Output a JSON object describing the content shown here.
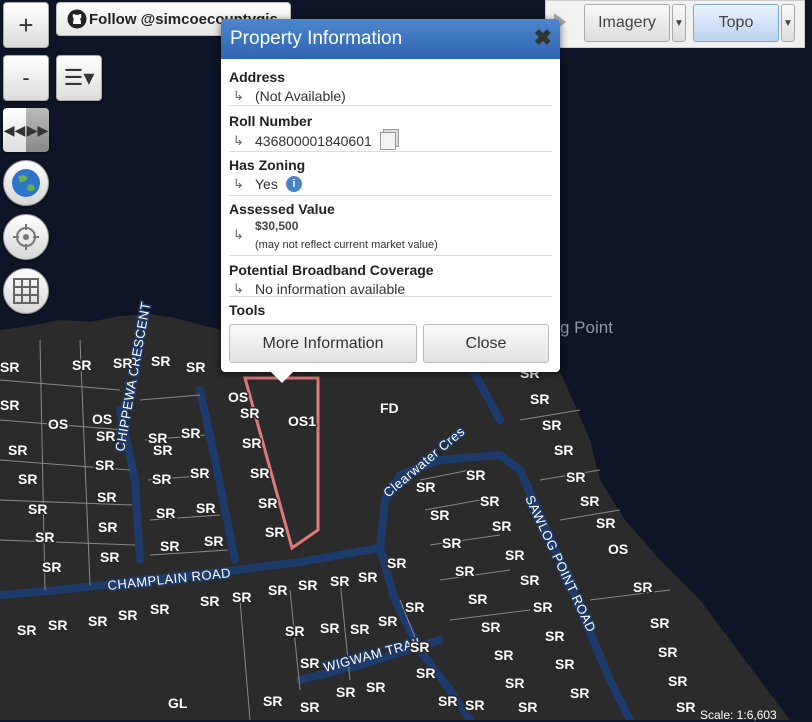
{
  "follow_button": {
    "label": "Follow @simcoecountygis"
  },
  "controls": {
    "zoom_in": "+",
    "zoom_out": "-"
  },
  "basemap": {
    "imagery_label": "Imagery",
    "topo_label": "Topo"
  },
  "popup": {
    "title": "Property Information",
    "close_glyph": "✖",
    "address": {
      "label": "Address",
      "value": "(Not Available)"
    },
    "roll": {
      "label": "Roll Number",
      "value": "436800001840601"
    },
    "zoning": {
      "label": "Has Zoning",
      "value": "Yes"
    },
    "assessed": {
      "label": "Assessed Value",
      "value": "$30,500",
      "note": "(may not reflect current market value)"
    },
    "broadband": {
      "label": "Potential Broadband Coverage",
      "value": "No information available"
    },
    "tools": {
      "label": "Tools"
    },
    "more_button": "More Information",
    "close_button": "Close"
  },
  "map": {
    "roads": [
      "CHIPPEWA CRESCENT",
      "Clearwater Cres",
      "SAWLOG POINT ROAD",
      "CHAMPLAIN ROAD",
      "WIGWAM TRAIL"
    ],
    "place_label": "g Point",
    "zones": [
      "SR",
      "OS",
      "OS1",
      "FD",
      "GL"
    ],
    "scale": "Scale: 1:6,603"
  },
  "colors": {
    "water": "#0d1526",
    "land": "#2b2b2b",
    "road": "#1d3b6b",
    "parcel_line": "#b9b9b9",
    "highlight": "#e07a7a",
    "popup_header": "#3a6fbd"
  }
}
